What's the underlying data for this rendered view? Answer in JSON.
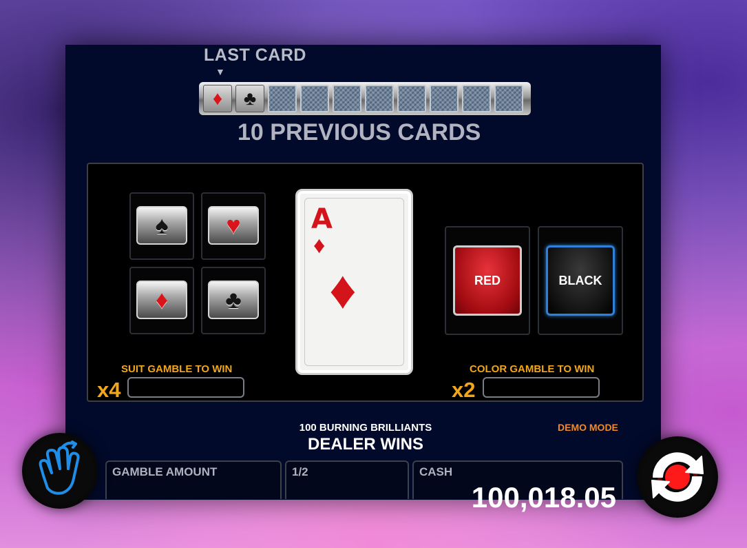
{
  "history": {
    "last_card_label": "LAST CARD",
    "arrow_glyph": "▼",
    "previous_label": "10 PREVIOUS CARDS",
    "slots": [
      {
        "kind": "face",
        "suit": "diamond",
        "glyph": "♦",
        "color": "#d9141a"
      },
      {
        "kind": "face",
        "suit": "club",
        "glyph": "♣",
        "color": "#151515"
      },
      {
        "kind": "back"
      },
      {
        "kind": "back"
      },
      {
        "kind": "back"
      },
      {
        "kind": "back"
      },
      {
        "kind": "back"
      },
      {
        "kind": "back"
      },
      {
        "kind": "back"
      },
      {
        "kind": "back"
      }
    ]
  },
  "suit_buttons": {
    "spade": {
      "glyph": "♠"
    },
    "heart": {
      "glyph": "♥"
    },
    "diamond": {
      "glyph": "♦"
    },
    "club": {
      "glyph": "♣"
    }
  },
  "current_card": {
    "rank": "A",
    "suit_glyph": "♦",
    "suit": "diamond",
    "color": "#d3141a"
  },
  "color_buttons": {
    "red_label": "RED",
    "black_label": "BLACK"
  },
  "suit_gamble": {
    "label": "SUIT GAMBLE TO WIN",
    "multiplier": "x4",
    "value": ""
  },
  "color_gamble": {
    "label": "COLOR GAMBLE TO WIN",
    "multiplier": "x2",
    "value": ""
  },
  "status": {
    "game_name": "100 BURNING BRILLIANTS",
    "message": "DEALER WINS",
    "demo_mode": "DEMO MODE"
  },
  "footer": {
    "gamble_amount_label": "GAMBLE AMOUNT",
    "gamble_amount_value": "",
    "half_label": "1/2",
    "cash_label": "CASH",
    "cash_value": "100,018.05"
  },
  "colors": {
    "accent_orange": "#f2a61a",
    "demo_orange": "#f08a24",
    "card_red": "#d3141a",
    "panel_bg": "#020a2b",
    "hand_icon_blue": "#1e8ee8",
    "spin_icon_red": "#ff1010"
  },
  "icons": {
    "left_button": "hand-collect-icon",
    "right_button": "refresh-spin-icon"
  }
}
